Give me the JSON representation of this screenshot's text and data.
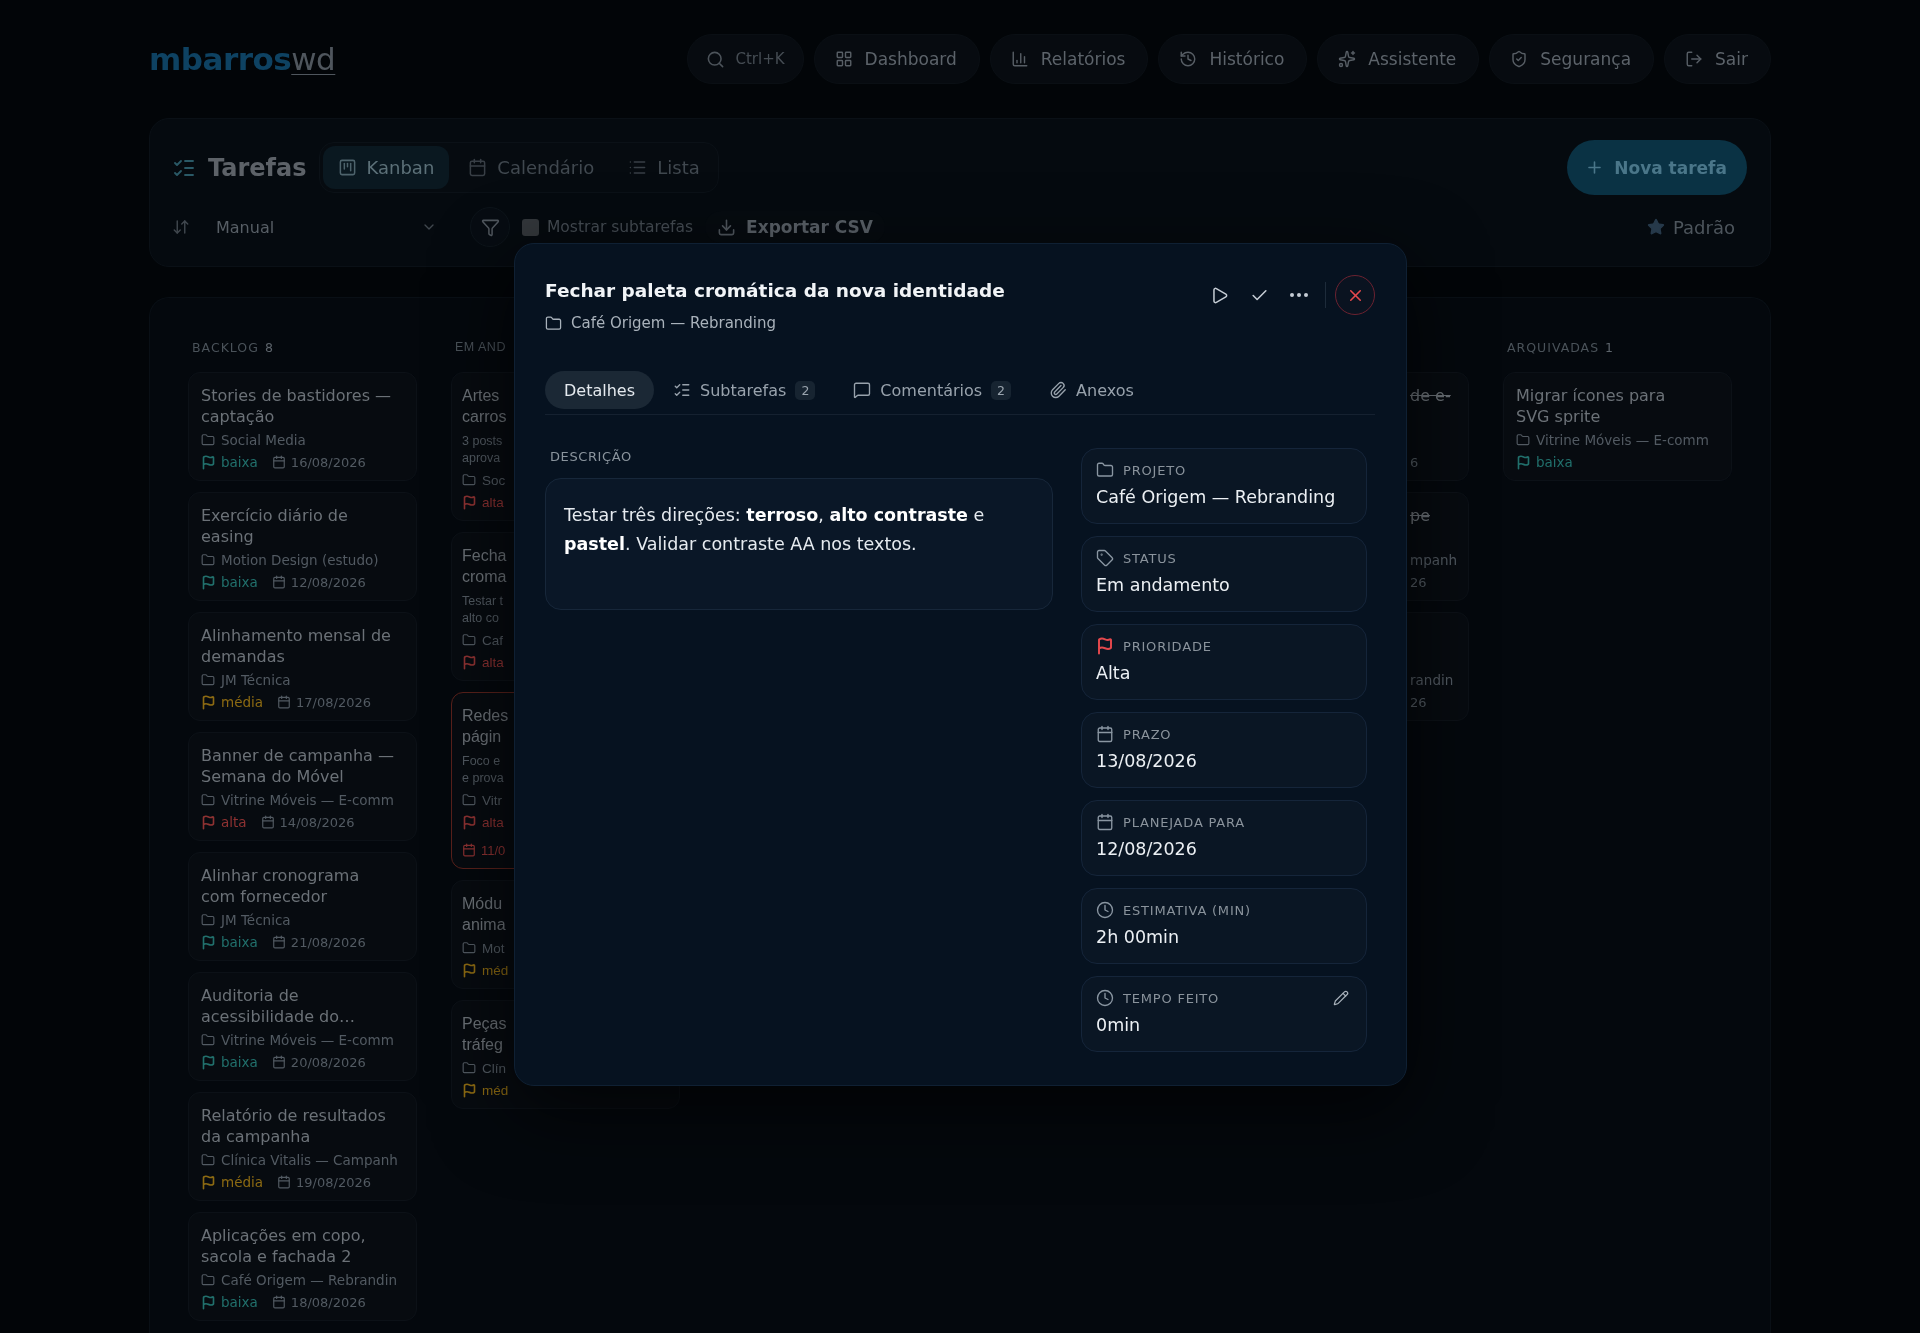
{
  "header": {
    "logo_main": "mbarros",
    "logo_suffix": "wd",
    "search_shortcut": "Ctrl+K",
    "nav": [
      "Dashboard",
      "Relatórios",
      "Histórico",
      "Assistente",
      "Segurança",
      "Sair"
    ]
  },
  "toolbar": {
    "title": "Tarefas",
    "views": [
      {
        "label": "Kanban",
        "selected": true
      },
      {
        "label": "Calendário",
        "selected": false
      },
      {
        "label": "Lista",
        "selected": false
      }
    ],
    "new_task_button": "Nova tarefa",
    "sort": "Manual",
    "show_subtasks": {
      "label": "Mostrar subtarefas",
      "checked": false
    },
    "export_button": "Exportar CSV",
    "preset": "Padrão"
  },
  "board": {
    "columns": [
      {
        "kind": "whole",
        "title": "BACKLOG",
        "count": "8",
        "cards": [
          {
            "title": "Stories de bastidores —\ncaptação",
            "project": "Social Media",
            "priority": {
              "label": "baixa",
              "color": "#21706c"
            },
            "date": "16/08/2026"
          },
          {
            "title": "Exercício diário de\neasing",
            "project": "Motion Design (estudo)",
            "priority": {
              "label": "baixa",
              "color": "#21706c"
            },
            "date": "12/08/2026"
          },
          {
            "title": "Alinhamento mensal de\ndemandas",
            "project": "JM Técnica",
            "priority": {
              "label": "média",
              "color": "#8c6a12"
            },
            "date": "17/08/2026"
          },
          {
            "title": "Banner de campanha —\nSemana do Móvel",
            "project": "Vitrine Móveis — E-comm",
            "priority": {
              "label": "alta",
              "color": "#8e3232"
            },
            "date": "14/08/2026"
          },
          {
            "title": "Alinhar cronograma\ncom fornecedor",
            "project": "JM Técnica",
            "priority": {
              "label": "baixa",
              "color": "#21706c"
            },
            "date": "21/08/2026"
          },
          {
            "title": "Auditoria de\nacessibilidade do…",
            "project": "Vitrine Móveis — E-comm",
            "priority": {
              "label": "baixa",
              "color": "#21706c"
            },
            "date": "20/08/2026"
          },
          {
            "title": "Relatório de resultados\nda campanha",
            "project": "Clínica Vitalis — Campanh",
            "priority": {
              "label": "média",
              "color": "#8c6a12"
            },
            "date": "19/08/2026"
          },
          {
            "title": "Aplicações em copo,\nsacola e fachada 2",
            "project": "Café Origem — Rebrandin",
            "priority": {
              "label": "baixa",
              "color": "#21706c"
            },
            "date": "18/08/2026"
          }
        ]
      },
      {
        "kind": "head",
        "title": "EM AND",
        "cards": [
          {
            "title": "Artes\ncarros",
            "description": "3 posts\naprova",
            "project": "Soc",
            "priority": {
              "label": "alta",
              "color": "#8e3232"
            },
            "overdue": false
          },
          {
            "title": "Fecha\ncroma",
            "description": "Testar t\nalto co",
            "project": "Caf",
            "priority": {
              "label": "alta",
              "color": "#8e3232"
            },
            "overdue": false
          },
          {
            "title": "Redes\npágin",
            "description": "Foco e\ne prova",
            "project": "Vitr",
            "priority": {
              "label": "alta",
              "color": "#8e3232"
            },
            "date": "11/0",
            "overdue": true
          },
          {
            "title": "Módu\nanima",
            "project": "Mot",
            "priority": {
              "label": "méd",
              "color": "#8c6a12"
            },
            "overdue": false
          },
          {
            "title": "Peças\ntráfeg",
            "project": "Clín",
            "priority": {
              "label": "méd",
              "color": "#8c6a12"
            },
            "overdue": false
          }
        ]
      },
      {
        "kind": "tail",
        "done": true,
        "cards": [
          {
            "title": "de e-",
            "date": "6"
          },
          {
            "title": "pe",
            "project": "mpanh",
            "date": "26"
          },
          {
            "project": "randin",
            "date": "26"
          }
        ]
      },
      {
        "kind": "whole",
        "title": "ARQUIVADAS",
        "count": "1",
        "cards": [
          {
            "title": "Migrar ícones para\nSVG sprite",
            "project": "Vitrine Móveis — E-comm",
            "priority": {
              "label": "baixa",
              "color": "#21706c"
            }
          }
        ]
      }
    ]
  },
  "modal": {
    "title": "Fechar paleta cromática da nova identidade",
    "project": "Café Origem — Rebranding",
    "tabs": [
      {
        "label": "Detalhes",
        "selected": true
      },
      {
        "label": "Subtarefas",
        "count": "2",
        "selected": false
      },
      {
        "label": "Comentários",
        "count": "2",
        "selected": false
      },
      {
        "label": "Anexos",
        "selected": false
      }
    ],
    "description_label": "DESCRIÇÃO",
    "description": "Testar três direções: **terroso**, **alto contraste** e **pastel**. Validar contraste AA nos textos.",
    "fields": [
      {
        "label": "PROJETO",
        "value": "Café Origem — Rebranding",
        "editable": false
      },
      {
        "label": "STATUS",
        "value": "Em andamento",
        "editable": false
      },
      {
        "label": "PRIORIDADE",
        "value": "Alta",
        "color": "#e5484d",
        "editable": false
      },
      {
        "label": "PRAZO",
        "value": "13/08/2026",
        "editable": false
      },
      {
        "label": "PLANEJADA PARA",
        "value": "12/08/2026",
        "editable": false
      },
      {
        "label": "ESTIMATIVA (MIN)",
        "value": "2h 00min",
        "editable": false
      },
      {
        "label": "TEMPO FEITO",
        "value": "0min",
        "editable": true
      }
    ]
  }
}
